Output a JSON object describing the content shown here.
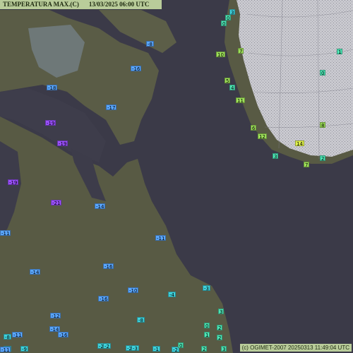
{
  "map": {
    "title_var": "TEMPERATURA MAX.(C)",
    "title_date": "13/03/2025 06:00 UTC",
    "credit": "(c) OGIMET-2007 20250313 11:49:04 UTC"
  },
  "colors": {
    "very_cold": "#9b51ff",
    "cold": "#5aa7ff",
    "cool": "#3fd2dc",
    "mild": "#4ee6b6",
    "warm": "#9ee05a",
    "warmer": "#dff24e",
    "land": "#5a5c46",
    "sea": "#3b3a48",
    "ice": "#c9c9cf",
    "label_bg": "#b9cc9a"
  },
  "stations": [
    {
      "v": "3",
      "c": "cool"
    },
    {
      "v": "0",
      "c": "mild"
    },
    {
      "v": "0",
      "c": "mild"
    },
    {
      "v": "10",
      "c": "warm"
    },
    {
      "v": "7",
      "c": "warm"
    },
    {
      "v": "1",
      "c": "mild"
    },
    {
      "v": "0",
      "c": "mild"
    },
    {
      "v": "5",
      "c": "warm"
    },
    {
      "v": "4",
      "c": "mild"
    },
    {
      "v": "11",
      "c": "warm"
    },
    {
      "v": "6",
      "c": "warm"
    },
    {
      "v": "12",
      "c": "warm"
    },
    {
      "v": "3",
      "c": "mild"
    },
    {
      "v": "14",
      "c": "warmer"
    },
    {
      "v": "8",
      "c": "warm"
    },
    {
      "v": "2",
      "c": "mild"
    },
    {
      "v": "7",
      "c": "warm"
    },
    {
      "v": "-8",
      "c": "cold"
    },
    {
      "v": "-16",
      "c": "cold"
    },
    {
      "v": "-18",
      "c": "cold"
    },
    {
      "v": "-17",
      "c": "cold"
    },
    {
      "v": "-19",
      "c": "very_cold"
    },
    {
      "v": "-19",
      "c": "very_cold"
    },
    {
      "v": "-19",
      "c": "very_cold"
    },
    {
      "v": "-21",
      "c": "very_cold"
    },
    {
      "v": "-14",
      "c": "cold"
    },
    {
      "v": "-11",
      "c": "cold"
    },
    {
      "v": "-11",
      "c": "cold"
    },
    {
      "v": "-14",
      "c": "cold"
    },
    {
      "v": "-16",
      "c": "cold"
    },
    {
      "v": "-10",
      "c": "cold"
    },
    {
      "v": "-16",
      "c": "cold"
    },
    {
      "v": "-4",
      "c": "cool"
    },
    {
      "v": "-3",
      "c": "cool"
    },
    {
      "v": "-12",
      "c": "cold"
    },
    {
      "v": "-8",
      "c": "cool"
    },
    {
      "v": "3",
      "c": "mild"
    },
    {
      "v": "-14",
      "c": "cold"
    },
    {
      "v": "-11",
      "c": "cold"
    },
    {
      "v": "-16",
      "c": "cold"
    },
    {
      "v": "-8",
      "c": "cool"
    },
    {
      "v": "0",
      "c": "mild"
    },
    {
      "v": "2",
      "c": "mild"
    },
    {
      "v": "1",
      "c": "mild"
    },
    {
      "v": "2",
      "c": "mild"
    },
    {
      "v": "-2",
      "c": "cool"
    },
    {
      "v": "-2",
      "c": "cool"
    },
    {
      "v": "-2",
      "c": "cool"
    },
    {
      "v": "-3",
      "c": "cool"
    },
    {
      "v": "-1",
      "c": "cool"
    },
    {
      "v": "-2",
      "c": "cool"
    },
    {
      "v": "0",
      "c": "mild"
    },
    {
      "v": "2",
      "c": "mild"
    },
    {
      "v": "3",
      "c": "mild"
    },
    {
      "v": "-9",
      "c": "cool"
    },
    {
      "v": "-6",
      "c": "cool"
    },
    {
      "v": "-11",
      "c": "cold"
    }
  ]
}
